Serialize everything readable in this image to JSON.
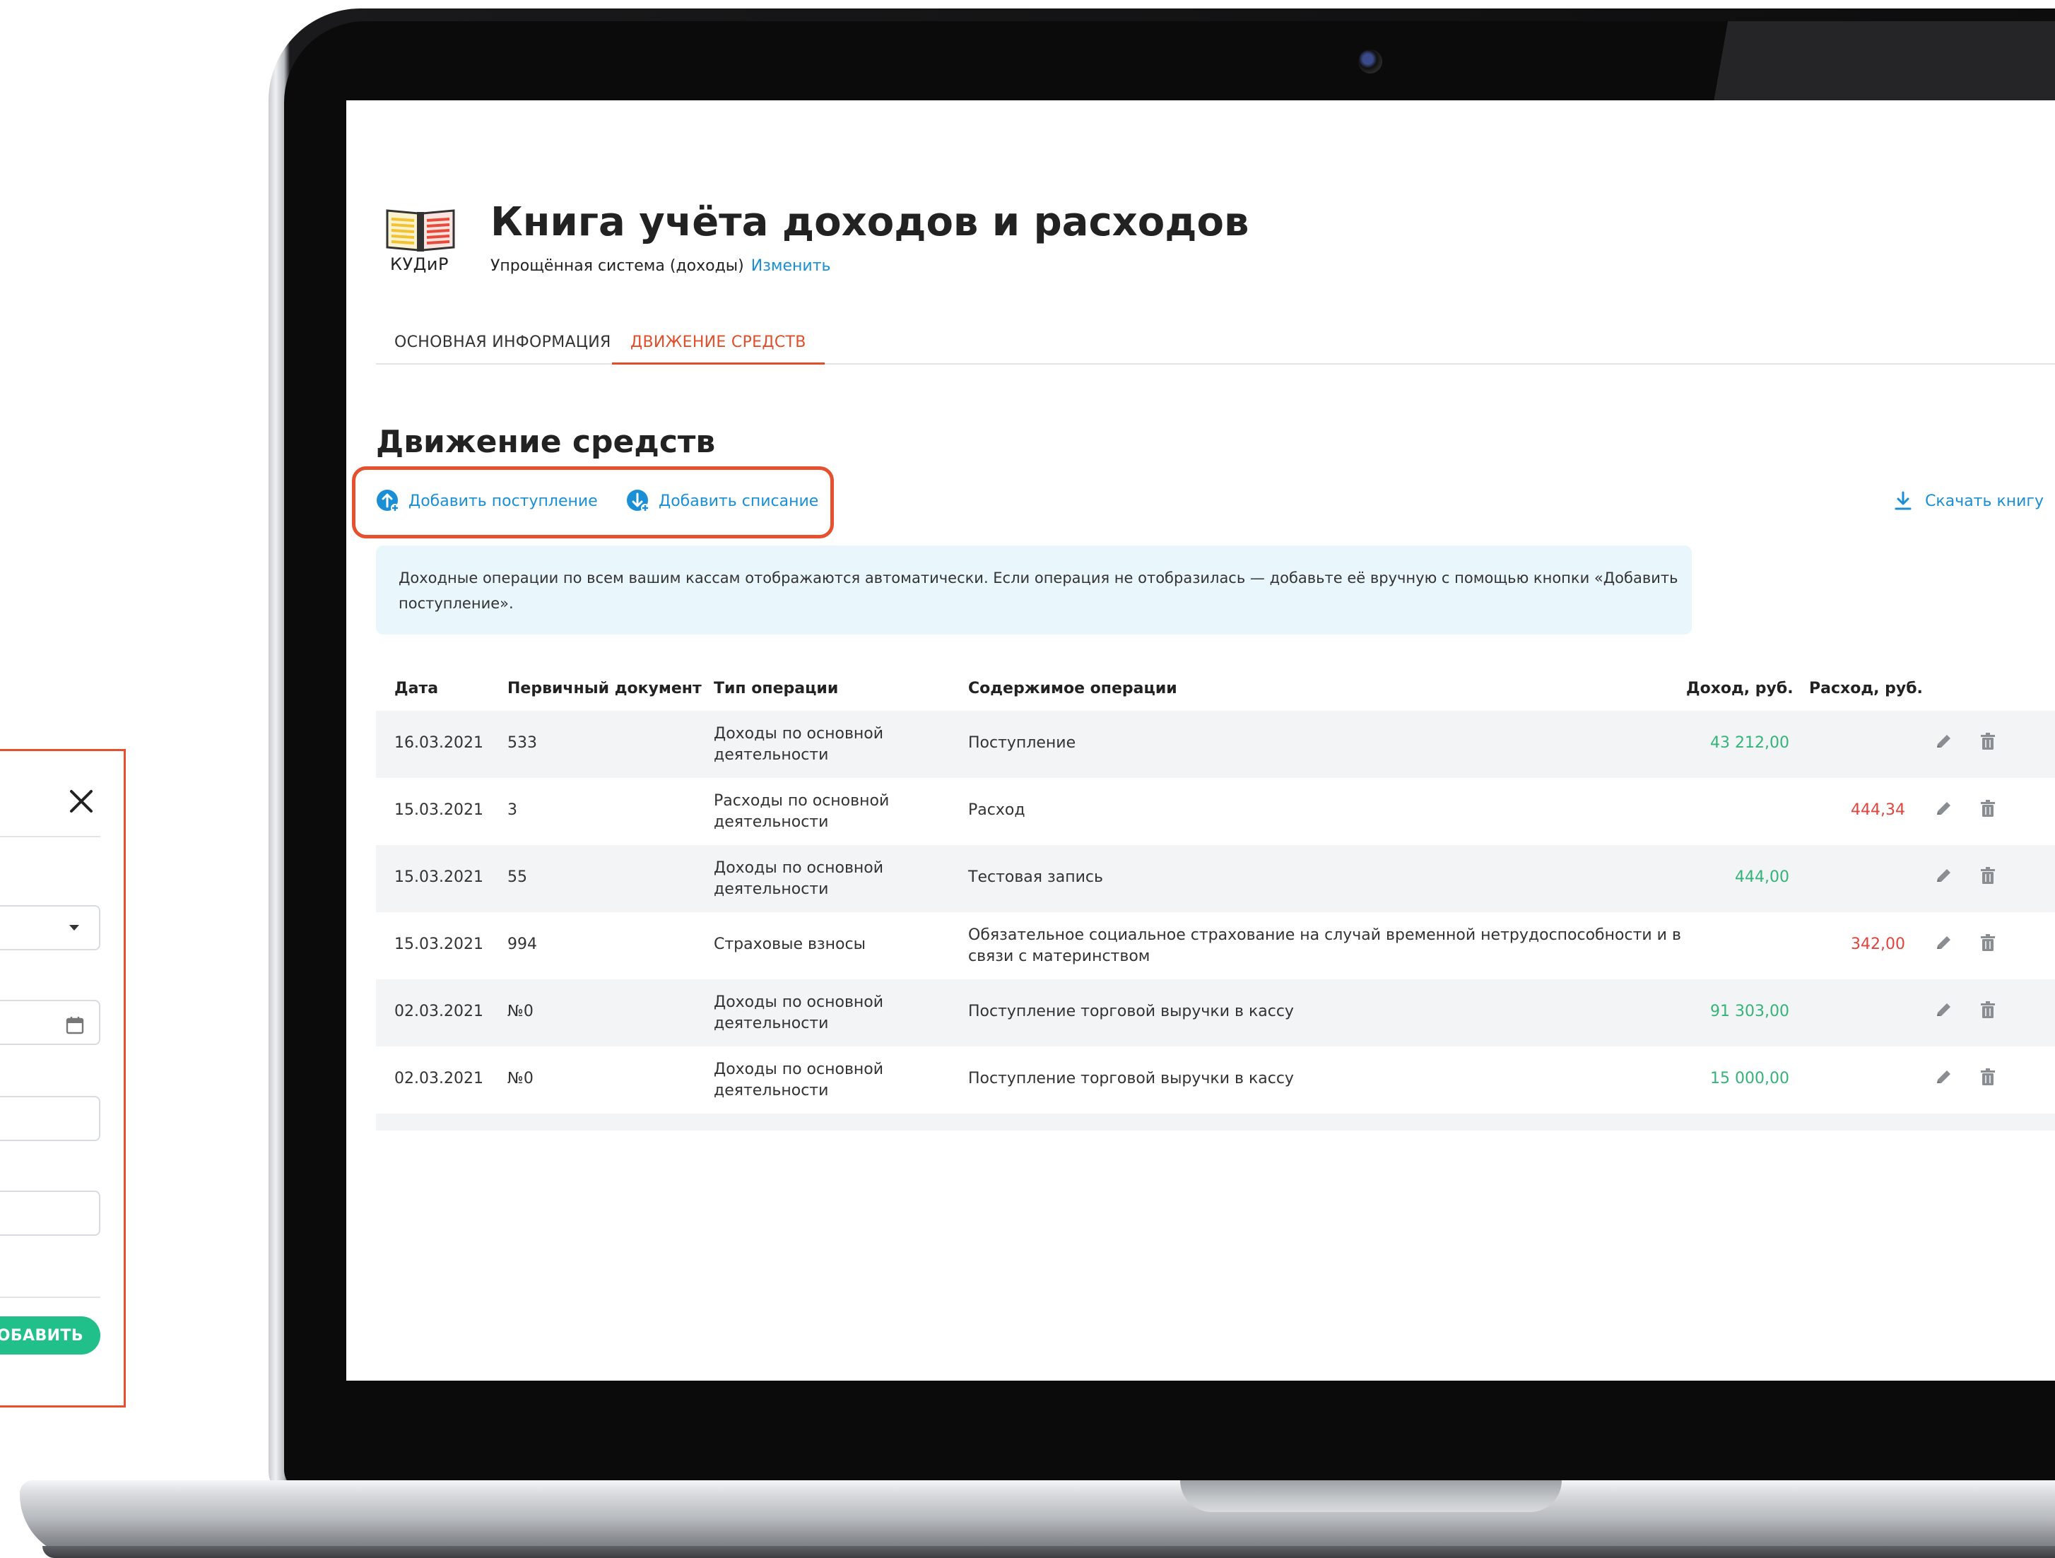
{
  "app": {
    "logo_text": "КУДиР",
    "title": "Книга учёта доходов и расходов",
    "tax_system": "Упрощённая система (доходы)",
    "change_link": "Изменить"
  },
  "tabs": [
    {
      "label": "ОСНОВНАЯ ИНФОРМАЦИЯ",
      "active": false
    },
    {
      "label": "ДВИЖЕНИЕ СРЕДСТВ",
      "active": true
    }
  ],
  "section": {
    "title": "Движение средств",
    "add_income_label": "Добавить поступление",
    "add_expense_label": "Добавить списание",
    "download_label": "Скачать книгу",
    "info_line1": "Доходные операции по всем вашим кассам отображаются автоматически. Если операция не отобразилась — добавьте её вручную с помощью кнопки «Добавить",
    "info_line2": "поступление»."
  },
  "table": {
    "headers": {
      "date": "Дата",
      "doc": "Первичный документ",
      "type": "Тип операции",
      "content": "Содержимое операции",
      "income": "Доход, руб.",
      "expense": "Расход, руб."
    },
    "rows": [
      {
        "date": "16.03.2021",
        "doc": "533",
        "type_l1": "Доходы по основной",
        "type_l2": "деятельности",
        "content_l1": "Поступление",
        "content_l2": "",
        "income": "43 212,00",
        "expense": ""
      },
      {
        "date": "15.03.2021",
        "doc": "3",
        "type_l1": "Расходы по основной",
        "type_l2": "деятельности",
        "content_l1": "Расход",
        "content_l2": "",
        "income": "",
        "expense": "444,34"
      },
      {
        "date": "15.03.2021",
        "doc": "55",
        "type_l1": "Доходы по основной",
        "type_l2": "деятельности",
        "content_l1": "Тестовая запись",
        "content_l2": "",
        "income": "444,00",
        "expense": ""
      },
      {
        "date": "15.03.2021",
        "doc": "994",
        "type_l1": "Страховые взносы",
        "type_l2": "",
        "content_l1": "Обязательное социальное страхование на случай временной нетрудоспособности и в",
        "content_l2": "связи с материнством",
        "income": "",
        "expense": "342,00"
      },
      {
        "date": "02.03.2021",
        "doc": "№0",
        "type_l1": "Доходы по основной",
        "type_l2": "деятельности",
        "content_l1": "Поступление торговой выручки в кассу",
        "content_l2": "",
        "income": "91 303,00",
        "expense": ""
      },
      {
        "date": "02.03.2021",
        "doc": "№0",
        "type_l1": "Доходы по основной",
        "type_l2": "деятельности",
        "content_l1": "Поступление торговой выручки в кассу",
        "content_l2": "",
        "income": "15 000,00",
        "expense": ""
      }
    ]
  },
  "dialog": {
    "add_button_label": "ДОБАВИТЬ"
  },
  "colors": {
    "accent_orange": "#e24d2a",
    "link_blue": "#1a8fd6",
    "income_green": "#35b379",
    "expense_red": "#e0443e",
    "button_green": "#21c08a",
    "info_bg": "#e9f7fd"
  },
  "icons": {
    "income": "arrow-up-circle-icon",
    "expense": "arrow-down-circle-icon",
    "download": "download-icon",
    "edit": "pencil-icon",
    "delete": "trash-icon",
    "close": "close-icon",
    "calendar": "calendar-icon"
  }
}
